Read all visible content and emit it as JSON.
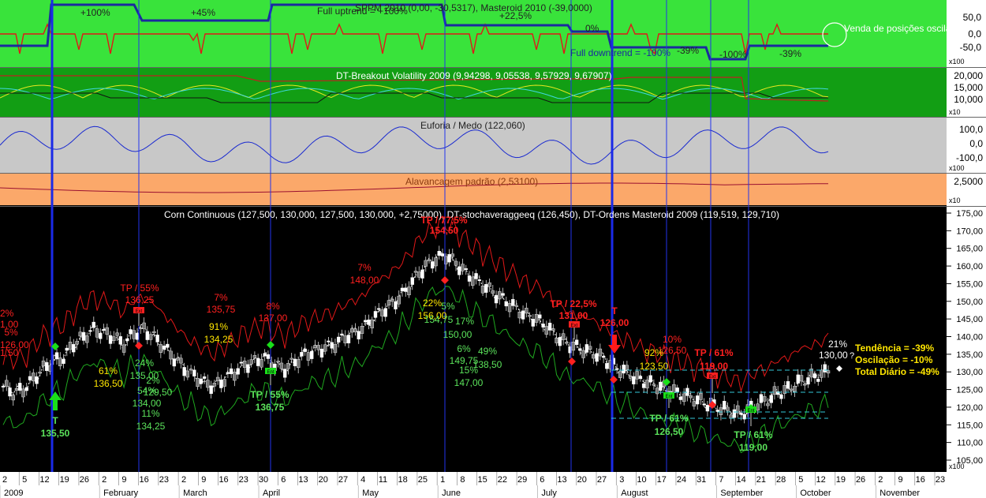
{
  "colors": {
    "panel1_bg": "#39e33b",
    "panel2_bg": "#129e14",
    "panel3_bg": "#c8c8c8",
    "panel4_bg": "#fba86a",
    "main_bg": "#000000",
    "axis_bg": "#ffffff",
    "trend_line": "#1a2a9e",
    "red": "#ff2020",
    "green_label": "#5be35b",
    "yellow_label": "#ffe600",
    "entry_arrow_green": "#1adf1a",
    "exit_arrow_red": "#ff1a1a",
    "cyan_dash": "#35c8d8",
    "blue_vline": "#2233ee"
  },
  "panels": {
    "sppm": {
      "title": "SPPM 2010 (0,00, -30,5317), Masteroid 2010 (-39,0000)",
      "uptrend_label": "Full uptrend = +100%",
      "downtrend_label": "Full downtrend = -100%",
      "pct_labels": [
        "+100%",
        "+45%",
        "+22,5%",
        "0%",
        "-39%",
        "-100%",
        "-39%"
      ],
      "note": "Venda de posições oscilatórias",
      "ticks": [
        "50,0",
        "0,0",
        "-50,0"
      ],
      "multiplier": "x100"
    },
    "volatility": {
      "title": "DT-Breakout Volatility 2009 (9,94298, 9,05538, 9,57929, 9,67907)",
      "ticks": [
        "20,000",
        "15,000",
        "10,000"
      ],
      "multiplier": "x10"
    },
    "euforia": {
      "title": "Euforia / Medo (122,060)",
      "ticks": [
        "100,0",
        "0,0",
        "-100,0"
      ],
      "multiplier": "x100"
    },
    "alavancagem": {
      "title": "Alavancagem padrão (2,53100)",
      "ticks": [
        "2,5000"
      ],
      "multiplier": "x10"
    },
    "main": {
      "title": "Corn Continuous (127,500, 130,000, 127,500, 130,000, +2,75000), DT-stochaveraggeeq (126,450), DT-Ordens Masteroid 2009 (119,519, 129,710)",
      "multiplier": "x100",
      "summary": [
        "Tendência = -39%",
        "Oscilação = -10%",
        "Total Diário = -49%"
      ],
      "last_price": [
        "21%",
        "130,00"
      ]
    }
  },
  "chart_data": {
    "type": "candlestick",
    "instrument": "Corn Continuous",
    "ylim": [
      105,
      175
    ],
    "yticks": [
      "175,00",
      "170,00",
      "165,00",
      "160,00",
      "155,00",
      "150,00",
      "145,00",
      "140,00",
      "135,00",
      "130,00",
      "125,00",
      "120,00",
      "115,00",
      "110,00",
      "105,00"
    ],
    "xaxis_days": [
      "2",
      "5",
      "12",
      "19",
      "26",
      "2",
      "9",
      "16",
      "23",
      "2",
      "9",
      "16",
      "23",
      "30",
      "6",
      "13",
      "20",
      "27",
      "4",
      "11",
      "18",
      "25",
      "1",
      "8",
      "15",
      "22",
      "29",
      "6",
      "13",
      "20",
      "27",
      "3",
      "10",
      "17",
      "24",
      "31",
      "7",
      "14",
      "21",
      "28",
      "5",
      "12",
      "19",
      "26",
      "2",
      "9",
      "16",
      "23"
    ],
    "xaxis_months": [
      "2009",
      "February",
      "March",
      "April",
      "May",
      "June",
      "July",
      "August",
      "September",
      "October",
      "November"
    ],
    "annotations": [
      {
        "text": "TP / 55%",
        "color": "red"
      },
      {
        "text": "136,25",
        "color": "red"
      },
      {
        "text": "7%",
        "color": "red"
      },
      {
        "text": "135,75",
        "color": "red"
      },
      {
        "text": "8%",
        "color": "red"
      },
      {
        "text": "137,00",
        "color": "red"
      },
      {
        "text": "7%",
        "color": "red"
      },
      {
        "text": "148,00",
        "color": "red"
      },
      {
        "text": "TP / 77,5%",
        "color": "red"
      },
      {
        "text": "154,50",
        "color": "red"
      },
      {
        "text": "TP / 22,5%",
        "color": "red"
      },
      {
        "text": "131,00",
        "color": "red"
      },
      {
        "text": "T",
        "color": "red"
      },
      {
        "text": "126,00",
        "color": "red"
      },
      {
        "text": "10%",
        "color": "red"
      },
      {
        "text": "126,50",
        "color": "red"
      },
      {
        "text": "TP / 61%",
        "color": "red"
      },
      {
        "text": "119,00",
        "color": "red"
      },
      {
        "text": "61%",
        "color": "yellow"
      },
      {
        "text": "136,50",
        "color": "yellow"
      },
      {
        "text": "91%",
        "color": "yellow"
      },
      {
        "text": "134,25",
        "color": "yellow"
      },
      {
        "text": "22%",
        "color": "yellow"
      },
      {
        "text": "156,00",
        "color": "yellow"
      },
      {
        "text": "92%",
        "color": "yellow"
      },
      {
        "text": "123,50",
        "color": "yellow"
      },
      {
        "text": "24%",
        "color": "green"
      },
      {
        "text": "135,00",
        "color": "green"
      },
      {
        "text": "54%",
        "color": "green"
      },
      {
        "text": "129,50",
        "color": "green"
      },
      {
        "text": "2%",
        "color": "green"
      },
      {
        "text": "134,00",
        "color": "green"
      },
      {
        "text": "11%",
        "color": "green"
      },
      {
        "text": "134,25",
        "color": "green"
      },
      {
        "text": "5%",
        "color": "green"
      },
      {
        "text": "154,75",
        "color": "green"
      },
      {
        "text": "17%",
        "color": "green"
      },
      {
        "text": "150,00",
        "color": "green"
      },
      {
        "text": "6%",
        "color": "green"
      },
      {
        "text": "149,75",
        "color": "green"
      },
      {
        "text": "49%",
        "color": "green"
      },
      {
        "text": "138,50",
        "color": "green"
      },
      {
        "text": "15%",
        "color": "green"
      },
      {
        "text": "147,00",
        "color": "green"
      },
      {
        "text": "T",
        "color": "green"
      },
      {
        "text": "135,50",
        "color": "green"
      },
      {
        "text": "TP / 55%",
        "color": "green"
      },
      {
        "text": "136,75",
        "color": "green"
      },
      {
        "text": "TP / 61%",
        "color": "green"
      },
      {
        "text": "126,50",
        "color": "green"
      },
      {
        "text": "TP / 61%",
        "color": "green"
      },
      {
        "text": "119,00",
        "color": "green"
      },
      {
        "text": "2%",
        "color": "red"
      },
      {
        "text": "1,00",
        "color": "red"
      },
      {
        "text": "5%",
        "color": "red"
      },
      {
        "text": "126,00",
        "color": "red"
      },
      {
        "text": "1,50",
        "color": "red"
      }
    ],
    "price_path": [
      126,
      124,
      125,
      128,
      131,
      133,
      134,
      138,
      140,
      142,
      141,
      140,
      138,
      141,
      142,
      140,
      137,
      134,
      131,
      129,
      127,
      126,
      128,
      130,
      132,
      133,
      134,
      132,
      131,
      133,
      135,
      136,
      137,
      138,
      140,
      141,
      143,
      146,
      148,
      150,
      153,
      157,
      160,
      162,
      163,
      161,
      158,
      156,
      154,
      152,
      150,
      148,
      146,
      145,
      143,
      140,
      138,
      137,
      136,
      135,
      133,
      131,
      130,
      128,
      127,
      126,
      125,
      124,
      123,
      122,
      121,
      120,
      119,
      118,
      119,
      121,
      122,
      124,
      125,
      127,
      128,
      129,
      130
    ]
  },
  "labels": {
    "exit_tag": "Ext",
    "entry_tag": "Ent",
    "question": "?"
  }
}
